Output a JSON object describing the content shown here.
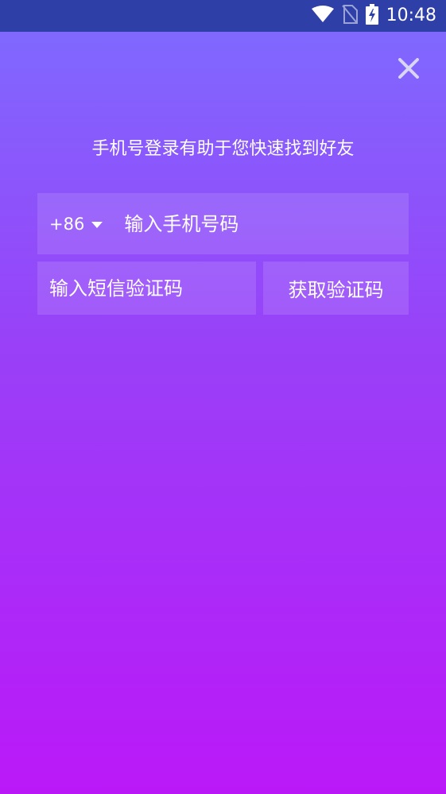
{
  "status_bar": {
    "time": "10:48",
    "icons": [
      "wifi-icon",
      "no-sim-icon",
      "battery-charging-icon"
    ]
  },
  "close_button": {
    "icon": "close-icon"
  },
  "subtitle": "手机号登录有助于您快速找到好友",
  "phone": {
    "country_code": "+86",
    "placeholder": "输入手机号码",
    "value": ""
  },
  "sms_code": {
    "placeholder": "输入短信验证码",
    "value": ""
  },
  "get_code_label": "获取验证码",
  "colors": {
    "status_bar": "#2f3fa8",
    "gradient_top": "#7d6cff",
    "gradient_bottom": "#bb18f8"
  }
}
